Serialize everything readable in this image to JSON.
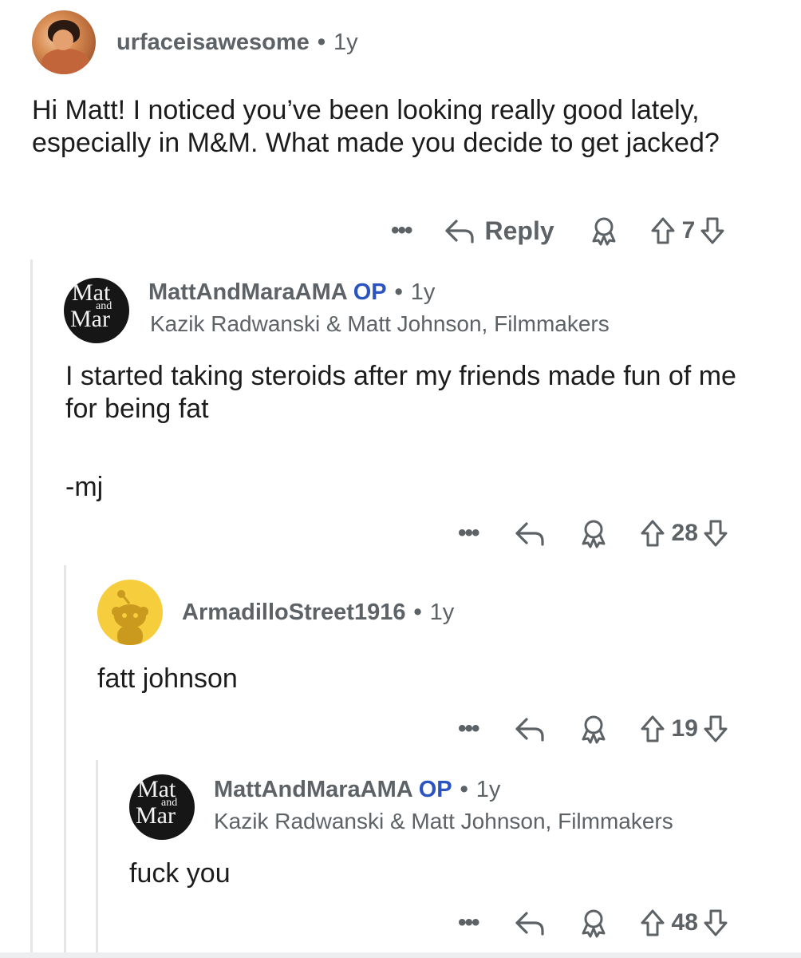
{
  "comments": [
    {
      "username": "urfaceisawesome",
      "age": "1y",
      "body": "Hi Matt! I noticed you’ve been looking really good lately, especially in M&M. What made you decide to get jacked?",
      "reply_label": "Reply",
      "votes": "7"
    },
    {
      "username": "MattAndMaraAMA",
      "op_tag": "OP",
      "age": "1y",
      "flair": "Kazik Radwanski  & Matt Johnson, Filmmakers",
      "body": "I started taking steroids after my friends made fun of me for being fat",
      "signature": "-mj",
      "votes": "28"
    },
    {
      "username": "ArmadilloStreet1916",
      "age": "1y",
      "body": "fatt johnson",
      "votes": "19"
    },
    {
      "username": "MattAndMaraAMA",
      "op_tag": "OP",
      "age": "1y",
      "flair": "Kazik Radwanski  & Matt Johnson, Filmmakers",
      "body": "fuck you",
      "votes": "48"
    }
  ],
  "avatar_mm_text": {
    "top": "Mat",
    "mid": "and",
    "bottom": "Mar"
  },
  "separator": "•",
  "more_label": "•••",
  "colors": {
    "meta_gray": "#5c6266",
    "op_blue": "#2b54c1",
    "thread_line": "#e4e6e8",
    "snoo_yellow": "#f6cd3c"
  }
}
